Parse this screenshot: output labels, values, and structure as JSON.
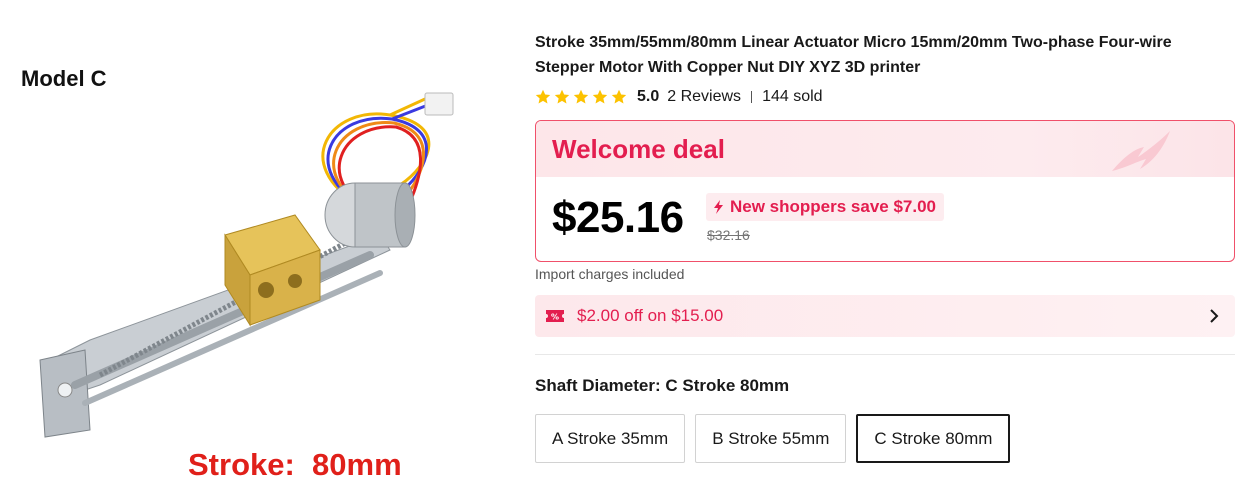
{
  "product_image": {
    "model_label": "Model C",
    "stroke_caption": "Stroke:  80mm"
  },
  "product": {
    "title": "Stroke 35mm/55mm/80mm Linear Actuator Micro 15mm/20mm Two-phase Four-wire Stepper Motor With Copper Nut DIY XYZ 3D printer",
    "rating": "5.0",
    "rating_value": 5,
    "reviews": "2 Reviews",
    "sold": "144 sold"
  },
  "deal": {
    "title": "Welcome deal",
    "price": "$25.16",
    "save_text": "New shoppers save $7.00",
    "original_price": "$32.16"
  },
  "import_note": "Import charges included",
  "coupon": {
    "text": "$2.00 off on $15.00",
    "icon_text": "%"
  },
  "variant": {
    "label": "Shaft Diameter: C Stroke 80mm",
    "options": [
      {
        "label": "A Stroke 35mm",
        "selected": false
      },
      {
        "label": "B Stroke 55mm",
        "selected": false
      },
      {
        "label": "C Stroke 80mm",
        "selected": true
      }
    ]
  },
  "colors": {
    "accent": "#e31e4f",
    "star": "#fcc200",
    "caption_red": "#e0201a"
  },
  "icons": [
    "star-icon",
    "flame-icon",
    "bolt-icon",
    "coupon-icon",
    "chevron-right-icon"
  ]
}
